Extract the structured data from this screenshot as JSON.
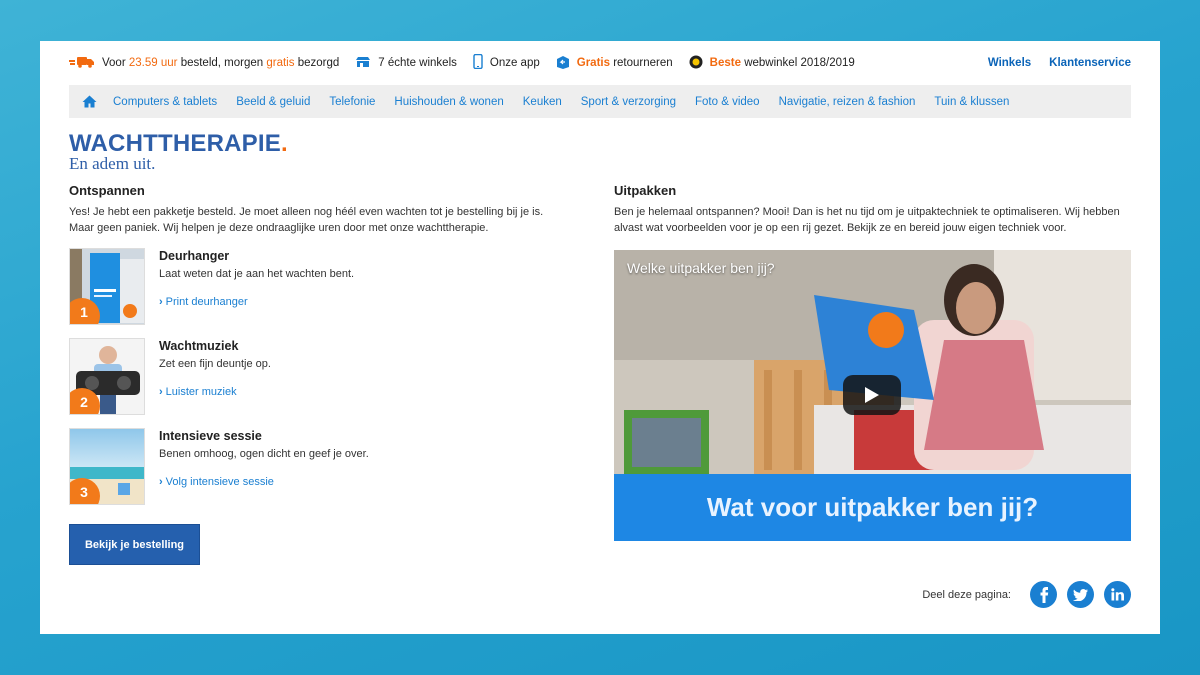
{
  "usp": {
    "delivery": {
      "before": "Voor",
      "time": "23.59 uur",
      "middle": "besteld, morgen",
      "highlight": "gratis",
      "after": "bezorgd"
    },
    "stores": "7 échte winkels",
    "app": "Onze app",
    "returns": {
      "highlight": "Gratis",
      "rest": "retourneren"
    },
    "award": {
      "highlight": "Beste",
      "rest": "webwinkel 2018/2019"
    }
  },
  "top_links": [
    "Winkels",
    "Klantenservice"
  ],
  "nav": [
    "Computers & tablets",
    "Beeld & geluid",
    "Telefonie",
    "Huishouden & wonen",
    "Keuken",
    "Sport & verzorging",
    "Foto & video",
    "Navigatie, reizen & fashion",
    "Tuin & klussen"
  ],
  "brand": {
    "title": "WACHTTHERAPIE",
    "dot": ".",
    "subtitle": "En adem uit."
  },
  "left": {
    "heading": "Ontspannen",
    "intro": "Yes! Je hebt een pakketje besteld. Je moet alleen nog héél even wachten tot je bestelling bij je is. Maar geen paniek. Wij helpen je deze ondraaglijke uren door met onze wachttherapie.",
    "steps": [
      {
        "num": "1",
        "title": "Deurhanger",
        "desc": "Laat weten dat je aan het wachten bent.",
        "link": "Print deurhanger"
      },
      {
        "num": "2",
        "title": "Wachtmuziek",
        "desc": "Zet een fijn deuntje op.",
        "link": "Luister muziek"
      },
      {
        "num": "3",
        "title": "Intensieve sessie",
        "desc": "Benen omhoog, ogen dicht en geef je over.",
        "link": "Volg intensieve sessie"
      }
    ],
    "cta": "Bekijk je bestelling"
  },
  "right": {
    "heading": "Uitpakken",
    "intro": "Ben je helemaal ontspannen? Mooi! Dan is het nu tijd om je uitpaktechniek te optimaliseren. Wij hebben alvast wat voorbeelden voor je op een rij gezet. Bekijk ze en bereid jouw eigen techniek voor.",
    "video_title": "Welke uitpakker ben jij?",
    "video_banner": "Wat voor uitpakker ben jij?"
  },
  "share": {
    "label": "Deel deze pagina:",
    "networks": [
      "facebook",
      "twitter",
      "linkedin"
    ]
  },
  "colors": {
    "accent": "#f26a10",
    "link": "#1a7fd1",
    "brand": "#2e5ea8",
    "button": "#2560ae"
  }
}
